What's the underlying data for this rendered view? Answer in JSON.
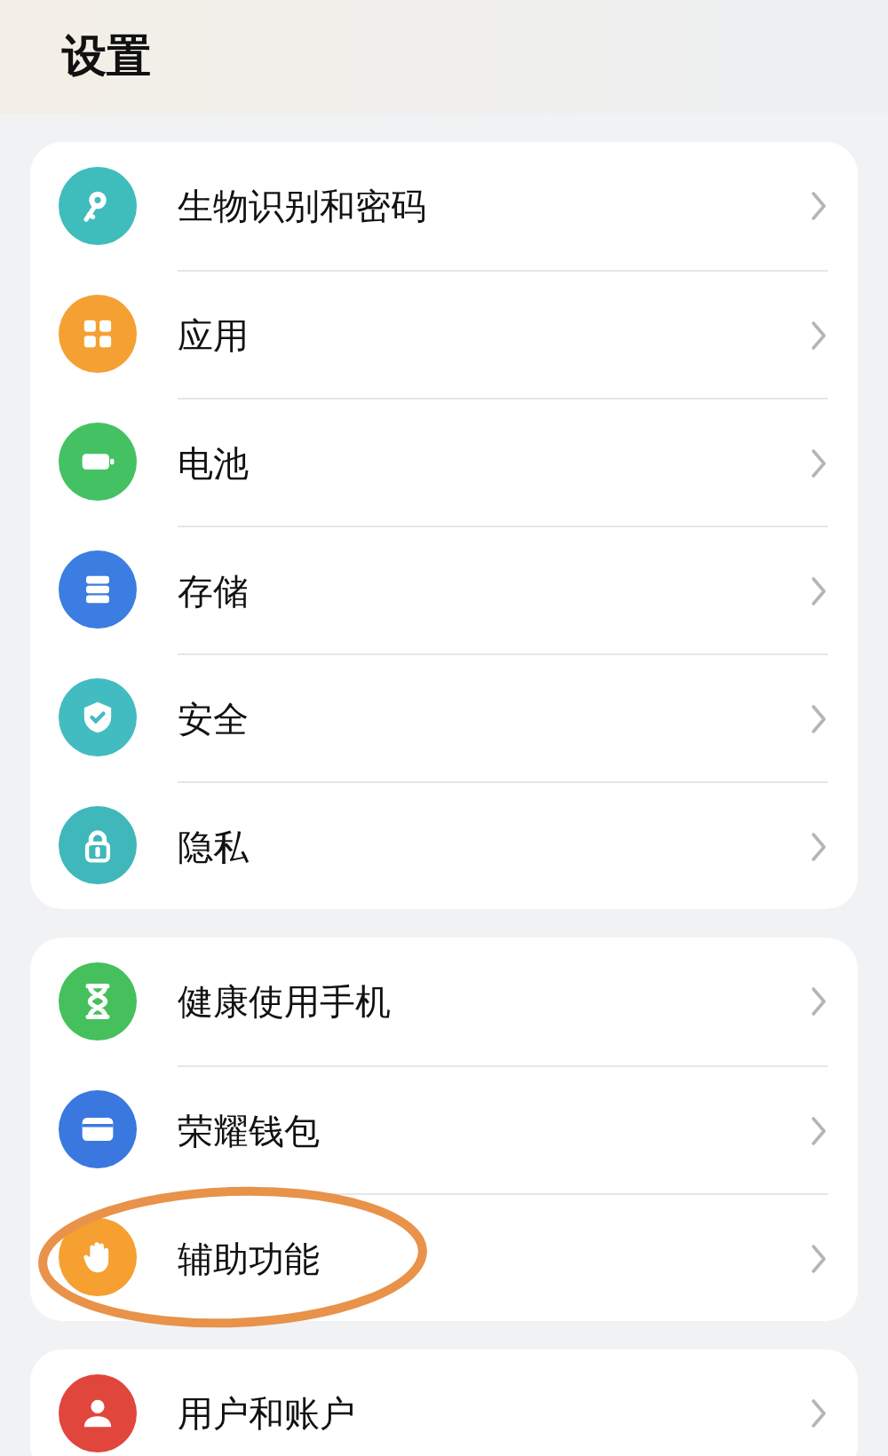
{
  "title": "设置",
  "groups": [
    {
      "items": [
        {
          "label": "生物识别和密码",
          "color": "#3fbcbc",
          "highlighted": false
        },
        {
          "label": "应用",
          "color": "#f5a033",
          "highlighted": false
        },
        {
          "label": "电池",
          "color": "#44c263",
          "highlighted": false
        },
        {
          "label": "存储",
          "color": "#3b7de0",
          "highlighted": false
        },
        {
          "label": "安全",
          "color": "#42bcc0",
          "highlighted": false
        },
        {
          "label": "隐私",
          "color": "#3fb7bb",
          "highlighted": false
        }
      ]
    },
    {
      "items": [
        {
          "label": "健康使用手机",
          "color": "#45c05c",
          "highlighted": false
        },
        {
          "label": "荣耀钱包",
          "color": "#3a78e0",
          "highlighted": false
        },
        {
          "label": "辅助功能",
          "color": "#f5a030",
          "highlighted": true
        }
      ]
    },
    {
      "items": [
        {
          "label": "用户和账户",
          "color": "#e0463c",
          "highlighted": false
        }
      ]
    }
  ]
}
